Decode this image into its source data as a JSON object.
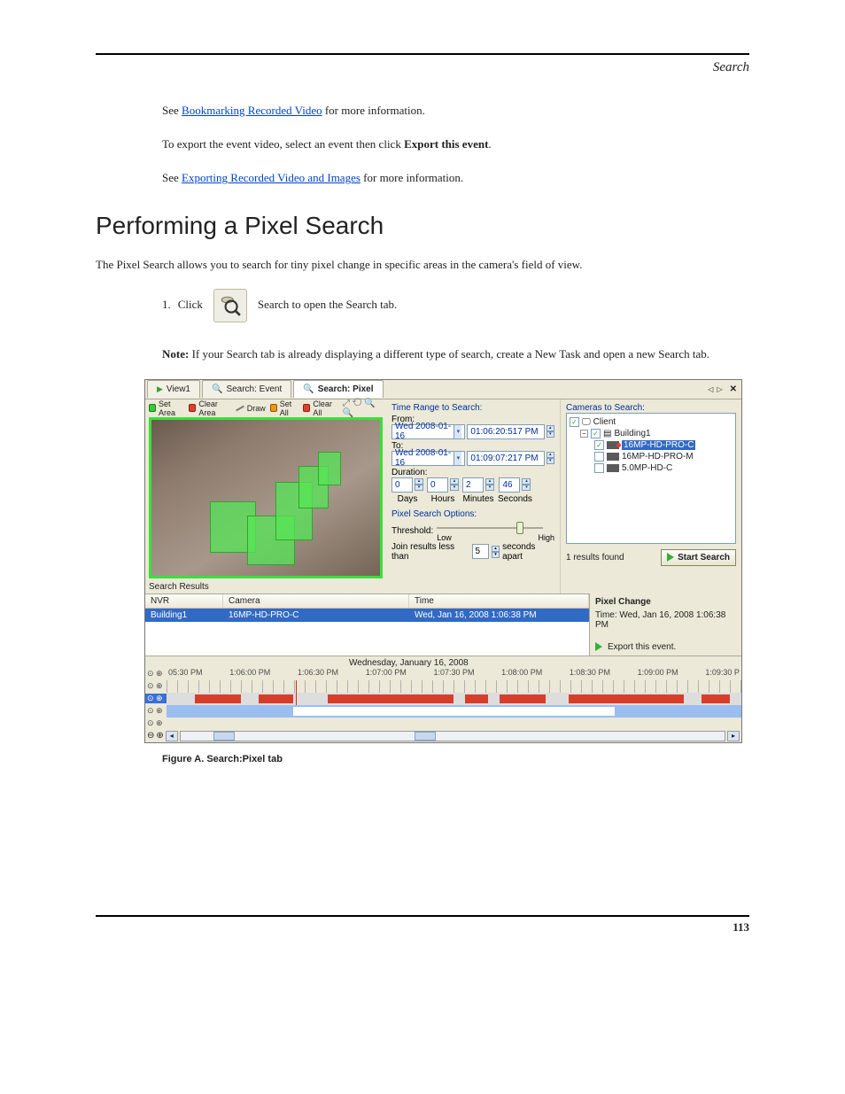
{
  "header": {
    "section": "Search"
  },
  "intro": {
    "line1_pre": "See ",
    "link1": "Bookmarking Recorded Video",
    "line1_post": " for more information.",
    "line2_pre": "To export the event video, select an event then click ",
    "line2_bold": "Export this event",
    "line2_post": ".",
    "line3_pre": "See ",
    "link2": "Exporting Recorded Video and Images",
    "line3_post": " for more information."
  },
  "title": "Performing a Pixel Search",
  "desc": "The Pixel Search allows you to search for tiny pixel change in specific areas in the camera's field of view.",
  "step1_a": "1.",
  "step1_b": "Click ",
  "step1_c": " Search to open the Search tab.",
  "note": {
    "label": "Note:",
    "text": " If your Search tab is already displaying a different type of search, create a New Task and open a new Search tab."
  },
  "shot": {
    "tabs": {
      "view": "View1",
      "event": "Search: Event",
      "pixel": "Search: Pixel"
    },
    "toolbar": {
      "setArea": "Set Area",
      "clearArea": "Clear Area",
      "draw": "Draw",
      "setAll": "Set All",
      "clearAll": "Clear All"
    },
    "searchResultsLabel": "Search Results",
    "time": {
      "title": "Time Range to Search:",
      "from": "From:",
      "fromDate": "Wed 2008-01-16",
      "fromTime": "01:06:20:517  PM",
      "to": "To:",
      "toDate": "Wed 2008-01-16",
      "toTime": "01:09:07:217  PM",
      "duration": "Duration:",
      "days": "0",
      "hours": "0",
      "minutes": "2",
      "seconds": "46",
      "daysL": "Days",
      "hoursL": "Hours",
      "minutesL": "Minutes",
      "secondsL": "Seconds"
    },
    "pix": {
      "title": "Pixel Search Options:",
      "threshold": "Threshold:",
      "low": "Low",
      "high": "High",
      "joinA": "Join results less than",
      "joinVal": "5",
      "joinB": "seconds apart"
    },
    "cams": {
      "title": "Cameras to Search:",
      "client": "Client",
      "building": "Building1",
      "c1": "16MP-HD-PRO-C",
      "c2": "16MP-HD-PRO-M",
      "c3": "5.0MP-HD-C",
      "found": "1 results found",
      "start": "Start Search"
    },
    "res": {
      "h1": "NVR",
      "h2": "Camera",
      "h3": "Time",
      "r1a": "Building1",
      "r1b": "16MP-HD-PRO-C",
      "r1c": "Wed, Jan 16, 2008 1:06:38 PM",
      "pcTitle": "Pixel Change",
      "pcTime": "Time: Wed, Jan 16, 2008 1:06:38 PM",
      "export": "Export this event."
    },
    "tl": {
      "date": "Wednesday, January 16, 2008",
      "t1": "05:30 PM",
      "t2": "1:06:00 PM",
      "t3": "1:06:30 PM",
      "t4": "1:07:00 PM",
      "t5": "1:07:30 PM",
      "t6": "1:08:00 PM",
      "t7": "1:08:30 PM",
      "t8": "1:09:00 PM",
      "t9": "1:09:30 P"
    }
  },
  "figcap": "Figure A. Search:Pixel tab",
  "pagenum": "113"
}
